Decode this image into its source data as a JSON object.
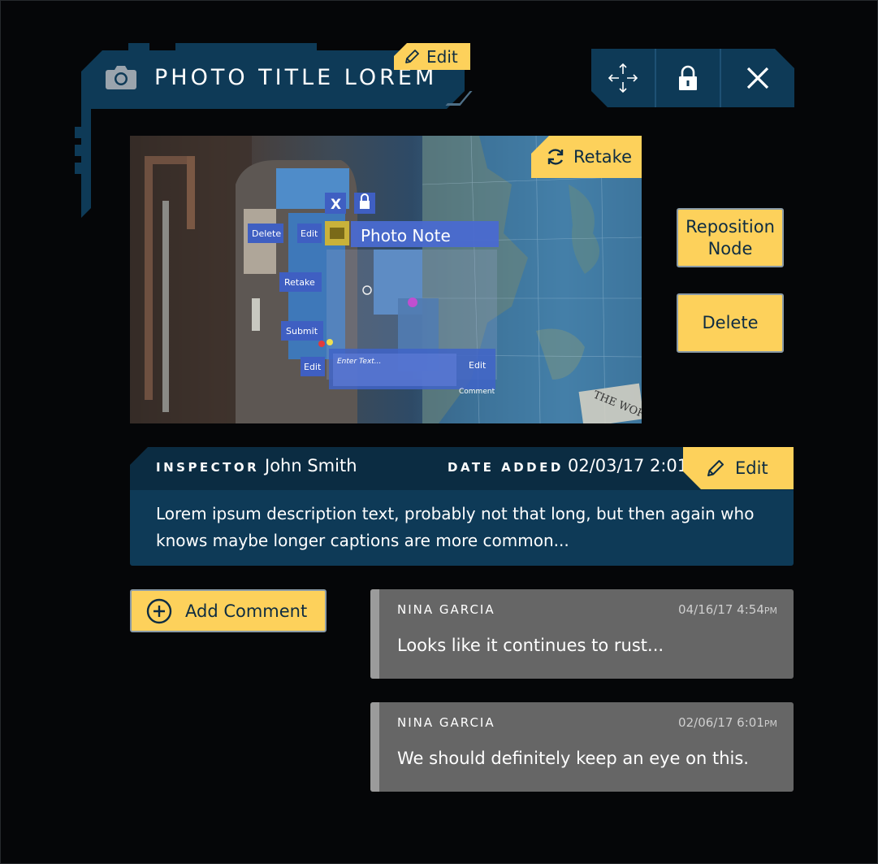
{
  "header": {
    "title": "PHOTO TITLE LOREM",
    "edit_label": "Edit",
    "camera_icon": "camera-icon"
  },
  "window_controls": [
    {
      "name": "move-icon"
    },
    {
      "name": "lock-icon"
    },
    {
      "name": "close-icon"
    }
  ],
  "photo": {
    "retake_label": "Retake",
    "overlay": {
      "close": "X",
      "delete": "Delete",
      "edit1": "Edit",
      "note_title": "Photo Note",
      "retake": "Retake",
      "submit": "Submit",
      "edit2": "Edit",
      "enter_text": "Enter Text...",
      "edit3": "Edit",
      "comment": "Comment",
      "map_text": "THE WORL"
    }
  },
  "side_actions": {
    "reposition_label": "Reposition Node",
    "delete_label": "Delete"
  },
  "info": {
    "inspector_label": "INSPECTOR",
    "inspector_value": "John Smith",
    "date_label": "DATE ADDED",
    "date_value": "02/03/17 2:01",
    "date_suffix": "P",
    "edit_label": "Edit",
    "description": "Lorem ipsum description text, probably not that long, but then again who knows maybe longer captions are more common..."
  },
  "add_comment_label": "Add Comment",
  "comments": [
    {
      "author": "NINA GARCIA",
      "date": "04/16/17 4:54",
      "ampm": "PM",
      "text": "Looks like it continues to rust..."
    },
    {
      "author": "NINA GARCIA",
      "date": "02/06/17 6:01",
      "ampm": "PM",
      "text": "We should definitely keep an eye on this."
    }
  ],
  "colors": {
    "panel": "#0e3a57",
    "panel_dark": "#0b2c42",
    "accent": "#fdd15b",
    "comment_bg": "#666666"
  }
}
